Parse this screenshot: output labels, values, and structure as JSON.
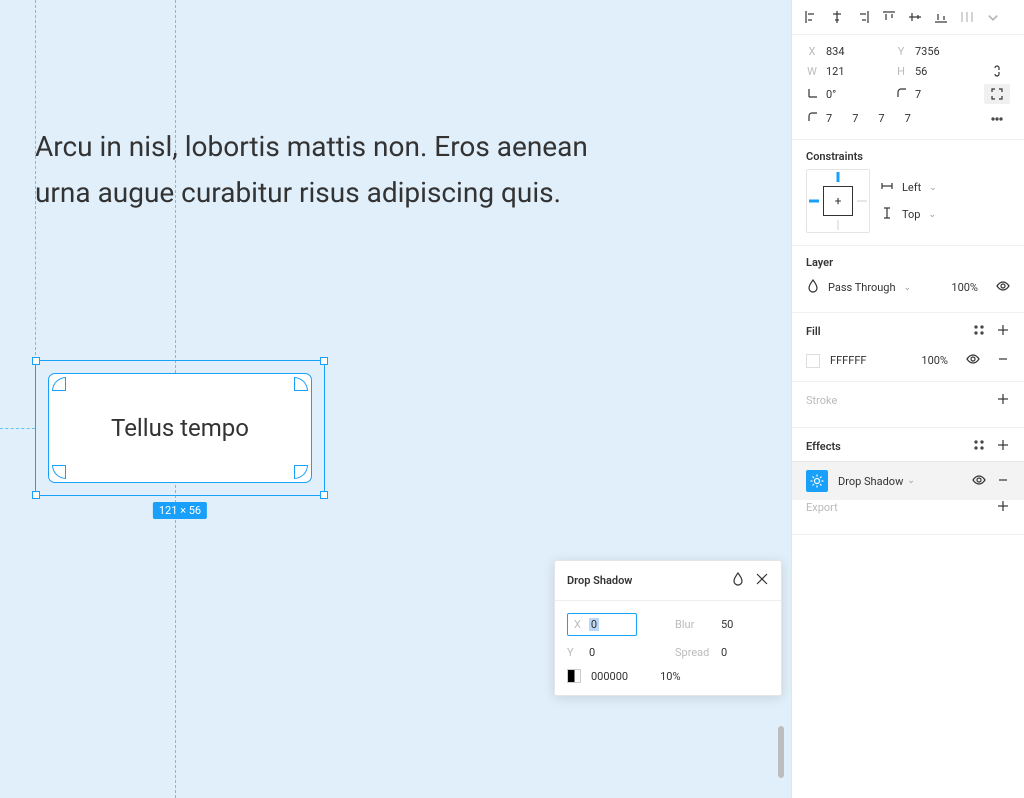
{
  "canvas": {
    "paragraph": "Arcu in nisl, lobortis mattis non. Eros aenean urna augue curabitur risus adipiscing quis.",
    "frame_label": "Tellus tempo",
    "size_badge": "121 × 56"
  },
  "popover": {
    "title": "Drop Shadow",
    "x_label": "X",
    "x_value": "0",
    "y_label": "Y",
    "y_value": "0",
    "blur_label": "Blur",
    "blur_value": "50",
    "spread_label": "Spread",
    "spread_value": "0",
    "color_hex": "000000",
    "opacity": "10%"
  },
  "transform": {
    "x_label": "X",
    "x_value": "834",
    "y_label": "Y",
    "y_value": "7356",
    "w_label": "W",
    "w_value": "121",
    "h_label": "H",
    "h_value": "56",
    "rot_value": "0°",
    "radius_single": "7",
    "corners": {
      "tl": "7",
      "tr": "7",
      "br": "7",
      "bl": "7"
    }
  },
  "constraints": {
    "title": "Constraints",
    "horizontal": "Left",
    "vertical": "Top"
  },
  "layer": {
    "title": "Layer",
    "blend": "Pass Through",
    "opacity": "100%"
  },
  "fill": {
    "title": "Fill",
    "hex": "FFFFFF",
    "opacity": "100%"
  },
  "stroke": {
    "title": "Stroke"
  },
  "effects": {
    "title": "Effects",
    "item_label": "Drop Shadow"
  },
  "export": {
    "title": "Export"
  }
}
